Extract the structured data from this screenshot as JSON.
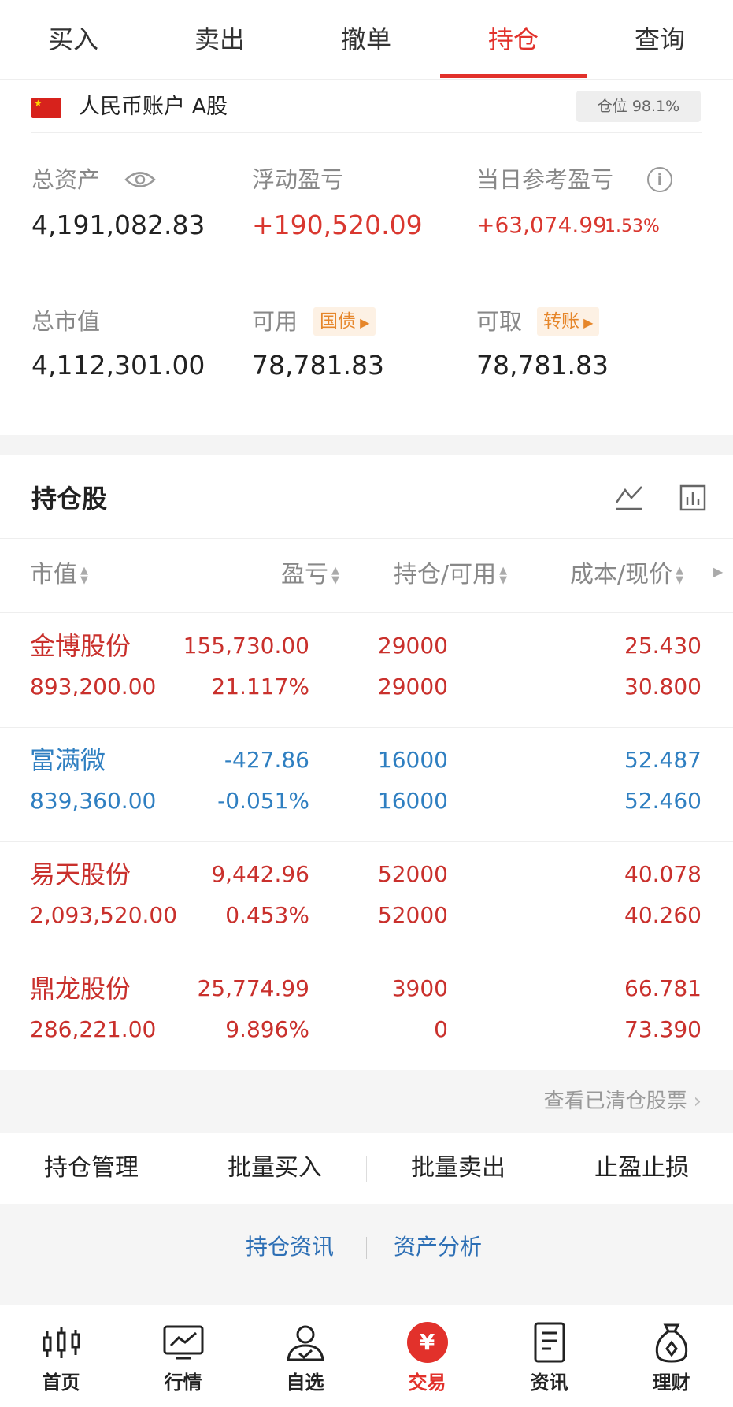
{
  "tabs": [
    "买入",
    "卖出",
    "撤单",
    "持仓",
    "查询"
  ],
  "account": {
    "label": "人民币账户 A股",
    "position_badge": "仓位 98.1%"
  },
  "metrics": {
    "total_assets": {
      "label": "总资产",
      "value": "4,191,082.83"
    },
    "floating_pnl": {
      "label": "浮动盈亏",
      "value": "+190,520.09"
    },
    "daily_pnl": {
      "label": "当日参考盈亏",
      "value": "+63,074.99",
      "pct": "1.53%"
    },
    "market_value": {
      "label": "总市值",
      "value": "4,112,301.00"
    },
    "available": {
      "label": "可用",
      "tag": "国债",
      "value": "78,781.83"
    },
    "withdrawable": {
      "label": "可取",
      "tag": "转账",
      "value": "78,781.83"
    }
  },
  "holdings": {
    "title": "持仓股",
    "columns": [
      "市值",
      "盈亏",
      "持仓/可用",
      "成本/现价"
    ],
    "rows": [
      {
        "name": "金博股份",
        "market_value": "893,200.00",
        "pnl": "155,730.00",
        "pnl_pct": "21.117%",
        "position": "29000",
        "available": "29000",
        "cost": "25.430",
        "price": "30.800",
        "color": "#c9302c"
      },
      {
        "name": "富满微",
        "market_value": "839,360.00",
        "pnl": "-427.86",
        "pnl_pct": "-0.051%",
        "position": "16000",
        "available": "16000",
        "cost": "52.487",
        "price": "52.460",
        "color": "#2f7fc1"
      },
      {
        "name": "易天股份",
        "market_value": "2,093,520.00",
        "pnl": "9,442.96",
        "pnl_pct": "0.453%",
        "position": "52000",
        "available": "52000",
        "cost": "40.078",
        "price": "40.260",
        "color": "#c9302c"
      },
      {
        "name": "鼎龙股份",
        "market_value": "286,221.00",
        "pnl": "25,774.99",
        "pnl_pct": "9.896%",
        "position": "3900",
        "available": "0",
        "cost": "66.781",
        "price": "73.390",
        "color": "#c9302c"
      }
    ],
    "cleared_link": "查看已清仓股票"
  },
  "actions": [
    "持仓管理",
    "批量买入",
    "批量卖出",
    "止盈止损"
  ],
  "news_links": [
    "持仓资讯",
    "资产分析"
  ],
  "bottom_nav": [
    {
      "label": "首页",
      "icon": "candlestick-icon"
    },
    {
      "label": "行情",
      "icon": "chart-monitor-icon"
    },
    {
      "label": "自选",
      "icon": "user-check-icon"
    },
    {
      "label": "交易",
      "icon": "yuan-icon",
      "glyph": "¥"
    },
    {
      "label": "资讯",
      "icon": "document-icon"
    },
    {
      "label": "理财",
      "icon": "money-bag-icon"
    }
  ],
  "colors": {
    "accent_red": "#e2312b",
    "up_red": "#c9302c",
    "down_blue": "#2f7fc1",
    "tag_orange": "#e6862a",
    "link_blue": "#2d6fb5"
  }
}
